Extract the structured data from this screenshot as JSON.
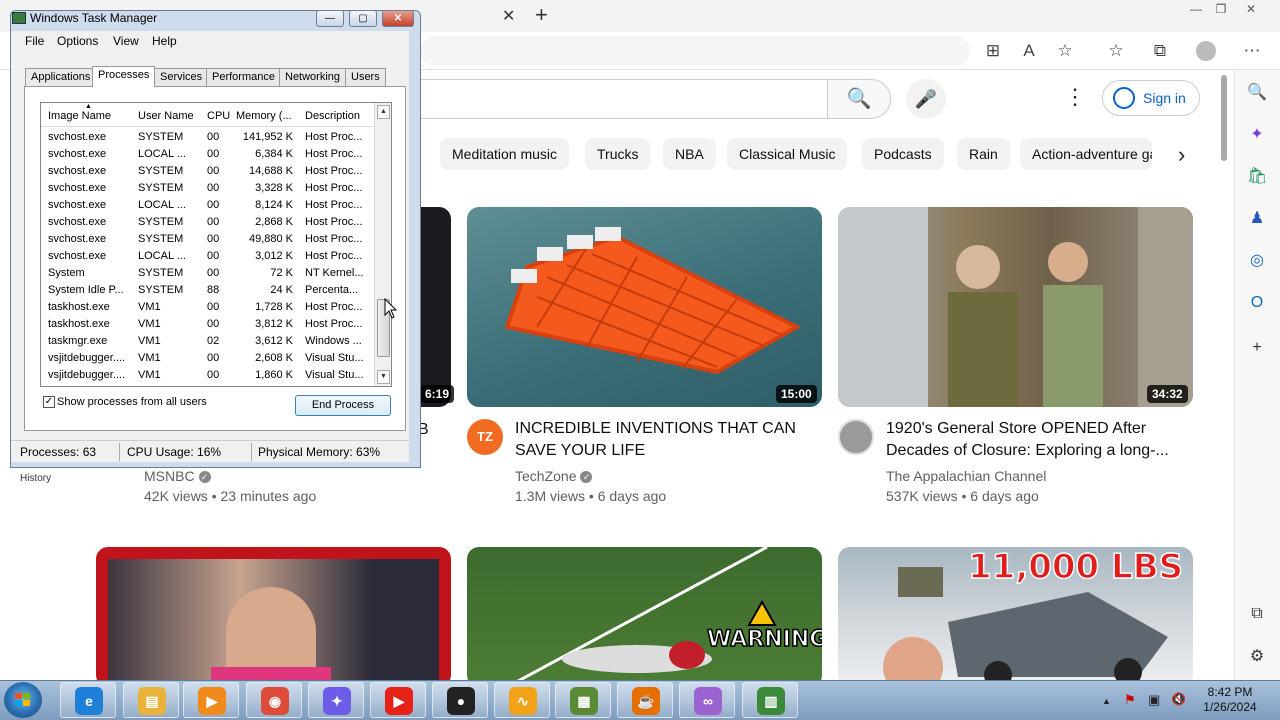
{
  "browser": {
    "tab_close_glyph": "✕",
    "tab_new_glyph": "+",
    "window_buttons": [
      "—",
      "❐",
      "✕"
    ],
    "toolbar_icons": [
      "app-grid-icon",
      "read-aloud-icon",
      "add-favorite-icon",
      "favorites-icon",
      "collections-icon",
      "profile-icon",
      "more-icon"
    ],
    "toolbar_glyphs": [
      "⊞",
      "A",
      "☆",
      "☆",
      "⧉",
      "",
      "⋯"
    ]
  },
  "youtube": {
    "search_glyph": "🔍",
    "mic_glyph": "🎤",
    "menu_glyph": "⋮",
    "signin_label": "Sign in",
    "chips": [
      "Meditation music",
      "Trucks",
      "NBA",
      "Classical Music",
      "Podcasts",
      "Rain",
      "Action-adventure games"
    ],
    "chip_next_glyph": "›",
    "history_label": "History",
    "videos": [
      {
        "duration": "6:19",
        "title": "",
        "channel": "MSNBC",
        "verified": true,
        "views": "42K views",
        "age": "23 minutes ago"
      },
      {
        "duration": "15:00",
        "title": "INCREDIBLE INVENTIONS THAT CAN SAVE YOUR LIFE",
        "channel": "TechZone",
        "verified": true,
        "views": "1.3M views",
        "age": "6 days ago",
        "avatar_text": "TZ"
      },
      {
        "duration": "34:32",
        "title": "1920's General Store OPENED After Decades of Closure: Exploring a long-...",
        "channel": "The Appalachian Channel",
        "verified": false,
        "views": "537K views",
        "age": "6 days ago"
      }
    ],
    "row2_overlays": {
      "warning": "WARNING",
      "weight": "11,000 LBS"
    },
    "left_title_fragment": "B"
  },
  "sidebar_icons": [
    "search-icon",
    "copilot-icon",
    "shopping-icon",
    "games-icon",
    "m365-icon",
    "outlook-icon",
    "add-icon",
    "split-screen-icon",
    "settings-icon"
  ],
  "sidebar_glyphs": [
    "🔍",
    "✦",
    "🛍",
    "♟",
    "◎",
    "O",
    "+",
    "⧉",
    "⚙"
  ],
  "sidebar_colors": [
    "#1a5fd4",
    "#7a3be0",
    "#1c8a5a",
    "#2456b8",
    "#1868c9",
    "#0f6cbd",
    "#333",
    "#333",
    "#333"
  ],
  "task_manager": {
    "title": "Windows Task Manager",
    "menu": [
      "File",
      "Options",
      "View",
      "Help"
    ],
    "tabs": [
      "Applications",
      "Processes",
      "Services",
      "Performance",
      "Networking",
      "Users"
    ],
    "active_tab": "Processes",
    "columns": [
      "Image Name",
      "User Name",
      "CPU",
      "Memory (...",
      "Description"
    ],
    "rows": [
      [
        "svchost.exe",
        "SYSTEM",
        "00",
        "141,952 K",
        "Host Proc..."
      ],
      [
        "svchost.exe",
        "LOCAL ...",
        "00",
        "6,384 K",
        "Host Proc..."
      ],
      [
        "svchost.exe",
        "SYSTEM",
        "00",
        "14,688 K",
        "Host Proc..."
      ],
      [
        "svchost.exe",
        "SYSTEM",
        "00",
        "3,328 K",
        "Host Proc..."
      ],
      [
        "svchost.exe",
        "LOCAL ...",
        "00",
        "8,124 K",
        "Host Proc..."
      ],
      [
        "svchost.exe",
        "SYSTEM",
        "00",
        "2,868 K",
        "Host Proc..."
      ],
      [
        "svchost.exe",
        "SYSTEM",
        "00",
        "49,880 K",
        "Host Proc..."
      ],
      [
        "svchost.exe",
        "LOCAL ...",
        "00",
        "3,012 K",
        "Host Proc..."
      ],
      [
        "System",
        "SYSTEM",
        "00",
        "72 K",
        "NT Kernel..."
      ],
      [
        "System Idle P...",
        "SYSTEM",
        "88",
        "24 K",
        "Percenta..."
      ],
      [
        "taskhost.exe",
        "VM1",
        "00",
        "1,728 K",
        "Host Proc..."
      ],
      [
        "taskhost.exe",
        "VM1",
        "00",
        "3,812 K",
        "Host Proc..."
      ],
      [
        "taskmgr.exe",
        "VM1",
        "02",
        "3,612 K",
        "Windows ..."
      ],
      [
        "vsjitdebugger....",
        "VM1",
        "00",
        "2,608 K",
        "Visual Stu..."
      ],
      [
        "vsjitdebugger....",
        "VM1",
        "00",
        "1,860 K",
        "Visual Stu..."
      ]
    ],
    "show_all_label": "Show processes from all users",
    "show_all_checked": true,
    "end_process_label": "End Process",
    "status": {
      "processes": "Processes: 63",
      "cpu": "CPU Usage: 16%",
      "memory": "Physical Memory: 63%"
    }
  },
  "taskbar": {
    "apps": [
      {
        "name": "edge",
        "color": "#1d7fd6",
        "glyph": "e"
      },
      {
        "name": "file-explorer",
        "color": "#e8b23b",
        "glyph": "▤"
      },
      {
        "name": "media-player",
        "color": "#f08a1c",
        "glyph": "▶"
      },
      {
        "name": "chrome",
        "color": "#dd4b39",
        "glyph": "◉"
      },
      {
        "name": "copilot",
        "color": "#6d5ce8",
        "glyph": "✦"
      },
      {
        "name": "youtube",
        "color": "#e62117",
        "glyph": "▶"
      },
      {
        "name": "obs",
        "color": "#222222",
        "glyph": "●"
      },
      {
        "name": "audacity",
        "color": "#f2a218",
        "glyph": "∿"
      },
      {
        "name": "minecraft",
        "color": "#5b8a36",
        "glyph": "▦"
      },
      {
        "name": "java",
        "color": "#e76f00",
        "glyph": "☕"
      },
      {
        "name": "visual-studio",
        "color": "#9a63d1",
        "glyph": "∞"
      },
      {
        "name": "task-manager",
        "color": "#3a8a3a",
        "glyph": "▥"
      }
    ],
    "tray_glyphs": [
      "▲",
      "⚑",
      "▣",
      "🔇"
    ],
    "time": "8:42 PM",
    "date": "1/26/2024"
  }
}
